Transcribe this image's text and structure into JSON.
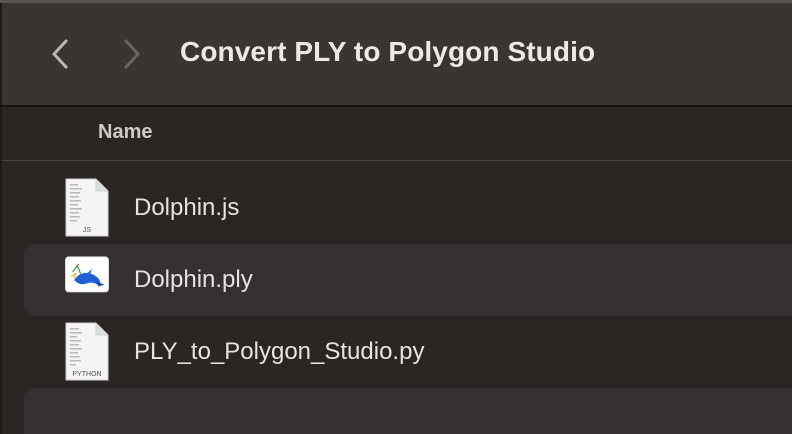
{
  "window": {
    "title": "Convert PLY to Polygon Studio"
  },
  "nav": {
    "back_icon": "chevron-left-icon",
    "forward_icon": "chevron-right-icon"
  },
  "columns": {
    "name_header": "Name"
  },
  "files": [
    {
      "name": "Dolphin.js",
      "icon": "js-document-icon",
      "badge": "JS"
    },
    {
      "name": "Dolphin.ply",
      "icon": "ply-model-icon",
      "badge": ""
    },
    {
      "name": "PLY_to_Polygon_Studio.py",
      "icon": "python-document-icon",
      "badge": "PYTHON"
    }
  ],
  "colors": {
    "toolbar": "#3a3533",
    "background": "#2b2624",
    "stripe": "#363130",
    "text": "#e7e3e1"
  }
}
